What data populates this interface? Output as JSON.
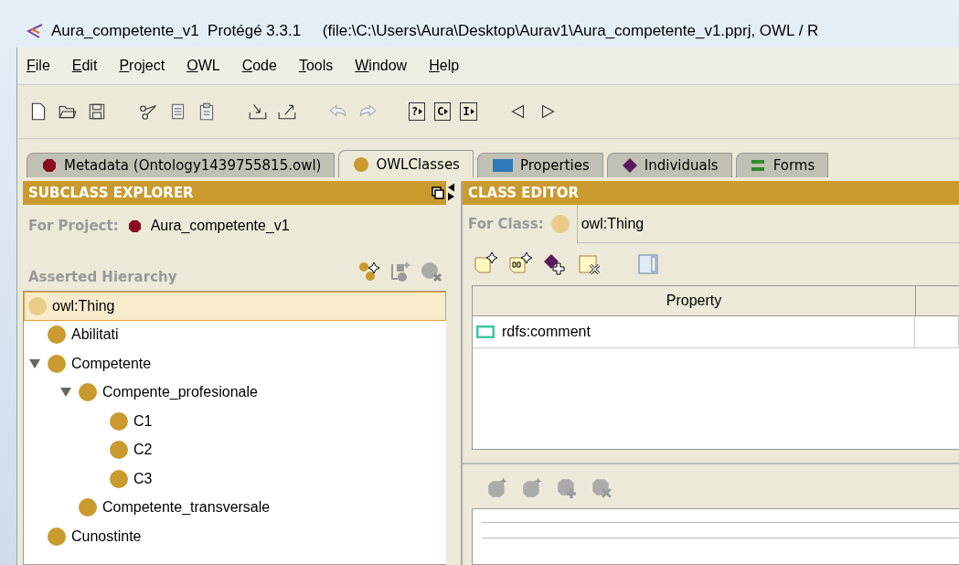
{
  "window": {
    "title": "Aura_competente_v1  Protégé 3.3.1     (file:\\C:\\Users\\Aura\\Desktop\\Aurav1\\Aura_competente_v1.pprj, OWL / R"
  },
  "menu": [
    "File",
    "Edit",
    "Project",
    "OWL",
    "Code",
    "Tools",
    "Window",
    "Help"
  ],
  "toolbar_letters": [
    "?",
    "C",
    "I"
  ],
  "tabs": [
    {
      "label": "Metadata (Ontology1439755815.owl)",
      "kind": "hexagon",
      "selected": false
    },
    {
      "label": "OWLClasses",
      "kind": "circle",
      "selected": true
    },
    {
      "label": "Properties",
      "kind": "square",
      "selected": false
    },
    {
      "label": "Individuals",
      "kind": "diamond",
      "selected": false
    },
    {
      "label": "Forms",
      "kind": "bars",
      "selected": false
    }
  ],
  "subclass_explorer": {
    "title": "SUBCLASS EXPLORER",
    "project_label": "For Project:",
    "project": "Aura_competente_v1",
    "hierarchy_label": "Asserted Hierarchy",
    "tree": [
      {
        "label": "owl:Thing",
        "selected": true,
        "children": [
          {
            "label": "Abilitati",
            "selected": false
          },
          {
            "label": "Competente",
            "selected": false,
            "expanded": true,
            "children": [
              {
                "label": "Compente_profesionale",
                "selected": false,
                "expanded": true,
                "children": [
                  {
                    "label": "C1",
                    "selected": false
                  },
                  {
                    "label": "C2",
                    "selected": false
                  },
                  {
                    "label": "C3",
                    "selected": false
                  }
                ]
              },
              {
                "label": "Competente_transversale",
                "selected": false
              }
            ]
          },
          {
            "label": "Cunostinte",
            "selected": false
          }
        ]
      }
    ]
  },
  "class_editor": {
    "title": "CLASS EDITOR",
    "class_label": "For Class:",
    "class_value": "owl:Thing",
    "table": {
      "columns": [
        "Property"
      ],
      "rows": [
        [
          "rdfs:comment"
        ]
      ]
    }
  }
}
